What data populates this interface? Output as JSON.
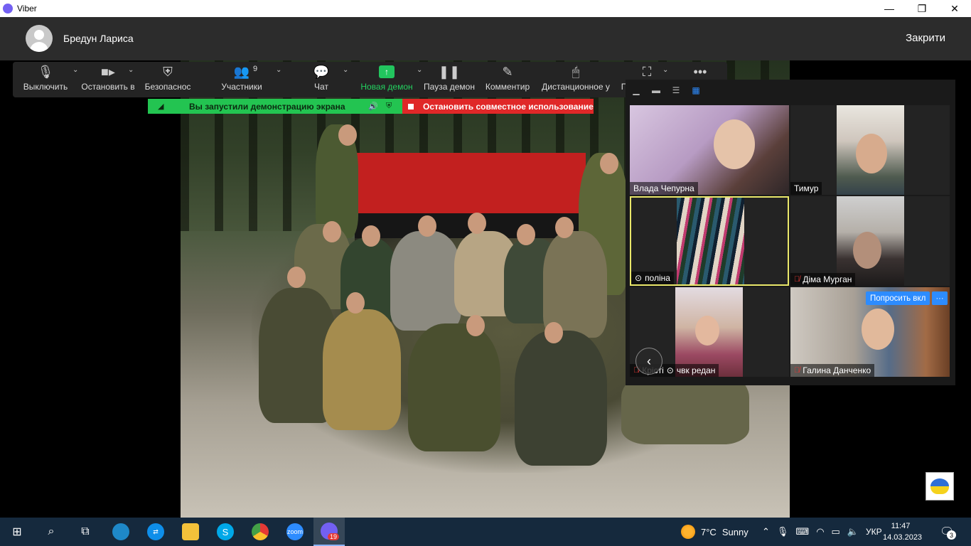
{
  "window": {
    "title": "Viber",
    "controls": [
      "minimize-icon",
      "restore-icon",
      "close-icon"
    ]
  },
  "call": {
    "caller_name": "Бредун Лариса",
    "close_label": "Закрити"
  },
  "toolbar": {
    "items": [
      {
        "label": "Выключить",
        "icon": "microphone-icon"
      },
      {
        "label": "Остановить в",
        "icon": "video-camera-icon"
      },
      {
        "label": "Безопаснос",
        "icon": "shield-icon"
      },
      {
        "label": "Участники",
        "icon": "participants-icon",
        "count": "9"
      },
      {
        "label": "Чат",
        "icon": "chat-icon"
      },
      {
        "label": "Новая демон",
        "icon": "share-screen-icon"
      },
      {
        "label": "Пауза демон",
        "icon": "pause-icon"
      },
      {
        "label": "Комментир",
        "icon": "pen-icon"
      },
      {
        "label": "Дистанционное у",
        "icon": "mouse-icon"
      },
      {
        "label": "П",
        "icon": "screenshot-icon"
      }
    ]
  },
  "sharing": {
    "status": "Вы запустили демонстрацию экрана",
    "stop_label": "Остановить совместное использование"
  },
  "gallery": {
    "participants": [
      {
        "name": "Влада Чепурна",
        "muted": false,
        "active": false
      },
      {
        "name": "Тимур",
        "muted": false,
        "active": false
      },
      {
        "name": "поліна",
        "muted": false,
        "active": true
      },
      {
        "name": "Діма Мурган",
        "muted": true,
        "active": false
      },
      {
        "name": "Крісті",
        "muted": true,
        "active": false
      },
      {
        "name": "чвк редан",
        "muted": false,
        "active": false
      },
      {
        "name": "Галина Данченко",
        "muted": true,
        "active": false
      }
    ],
    "ask_button": "Попросить вкл",
    "more_button": "···"
  },
  "taskbar": {
    "weather_temp": "7°C",
    "weather_text": "Sunny",
    "language": "УКР",
    "time": "11:47",
    "date": "14.03.2023",
    "viber_badge": "19",
    "notifications": "3",
    "zoom_label": "zoom"
  }
}
